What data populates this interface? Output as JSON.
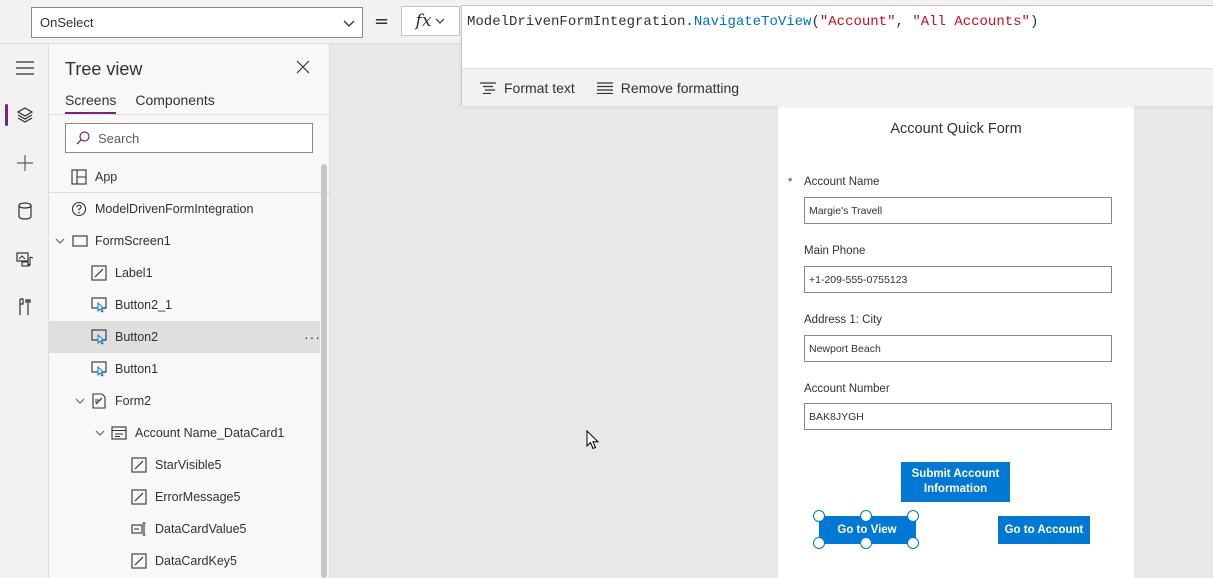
{
  "formula_bar": {
    "property": "OnSelect",
    "equals": "=",
    "fx": "fx",
    "formula_object": "ModelDrivenFormIntegration.",
    "formula_function": "NavigateToView",
    "formula_open": "(",
    "formula_arg1": "\"Account\"",
    "formula_sep": ", ",
    "formula_arg2": "\"All Accounts\"",
    "formula_close": ")",
    "format_text": "Format text",
    "remove_formatting": "Remove formatting"
  },
  "tree_view": {
    "title": "Tree view",
    "tabs": [
      "Screens",
      "Components"
    ],
    "search_placeholder": "Search",
    "nodes": [
      {
        "label": "App",
        "icon": "app-icon"
      },
      {
        "label": "ModelDrivenFormIntegration",
        "icon": "help-circle-icon"
      },
      {
        "label": "FormScreen1",
        "icon": "screen-icon"
      },
      {
        "label": "Label1",
        "icon": "edit-label-icon"
      },
      {
        "label": "Button2_1",
        "icon": "button-icon"
      },
      {
        "label": "Button2",
        "icon": "button-icon"
      },
      {
        "label": "Button1",
        "icon": "button-icon"
      },
      {
        "label": "Form2",
        "icon": "form-icon"
      },
      {
        "label": "Account Name_DataCard1",
        "icon": "datacard-icon"
      },
      {
        "label": "StarVisible5",
        "icon": "edit-label-icon"
      },
      {
        "label": "ErrorMessage5",
        "icon": "edit-label-icon"
      },
      {
        "label": "DataCardValue5",
        "icon": "textinput-icon"
      },
      {
        "label": "DataCardKey5",
        "icon": "edit-label-icon"
      }
    ],
    "more": "···"
  },
  "form": {
    "title": "Account Quick Form",
    "required_mark": "*",
    "fields": [
      {
        "label": "Account Name",
        "value": "Margie's Travell"
      },
      {
        "label": "Main Phone",
        "value": "+1-209-555-0755123"
      },
      {
        "label": "Address 1: City",
        "value": "Newport Beach"
      },
      {
        "label": "Account Number",
        "value": "BAK8JYGH"
      }
    ],
    "submit_button": "Submit Account Information",
    "view_button": "Go to View",
    "account_button": "Go to Account"
  },
  "colors": {
    "accent": "#742774",
    "button": "#0078d4",
    "function_token": "#0070c0",
    "string_token": "#c50f1f"
  }
}
